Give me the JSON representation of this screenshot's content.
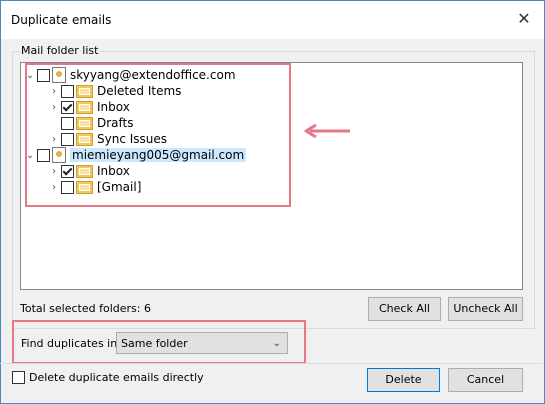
{
  "window": {
    "title": "Duplicate emails",
    "close_glyph": "✕"
  },
  "group": {
    "label": "Mail folder list"
  },
  "tree": {
    "accounts": [
      {
        "name": "skyyang@extendoffice.com",
        "checked": false,
        "folders": [
          {
            "name": "Deleted Items",
            "checked": false
          },
          {
            "name": "Inbox",
            "checked": true
          },
          {
            "name": "Drafts",
            "checked": false
          },
          {
            "name": "Sync Issues",
            "checked": false
          }
        ]
      },
      {
        "name": "miemieyang005@gmail.com",
        "checked": false,
        "selected": true,
        "folders": [
          {
            "name": "Inbox",
            "checked": true
          },
          {
            "name": "[Gmail]",
            "checked": false
          }
        ]
      }
    ]
  },
  "status": {
    "text": "Total selected folders:  6"
  },
  "buttons": {
    "check_all": "Check All",
    "uncheck_all": "Uncheck All",
    "delete": "Delete",
    "cancel": "Cancel"
  },
  "find": {
    "label": "Find duplicates in:",
    "value": "Same folder"
  },
  "options": {
    "delete_directly": {
      "label": "Delete duplicate emails directly",
      "checked": false
    }
  },
  "colors": {
    "highlight": "#e57787",
    "selection": "#cce8ff",
    "default_border": "#0078d7"
  }
}
